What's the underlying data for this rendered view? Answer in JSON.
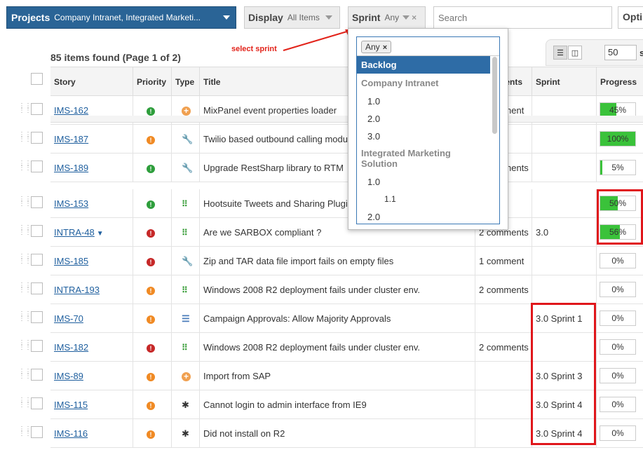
{
  "filters": {
    "projects": {
      "label": "Projects",
      "value": "Company Intranet, Integrated Marketi..."
    },
    "display": {
      "label": "Display",
      "value": "All Items"
    },
    "sprint": {
      "label": "Sprint",
      "value": "Any",
      "clear": "×"
    },
    "search": {
      "placeholder": "Search"
    },
    "options": {
      "label": "Opti"
    }
  },
  "annotation": {
    "text": "select sprint"
  },
  "results": {
    "summary": "85 items found (Page 1 of 2)"
  },
  "view": {
    "page_size": "50",
    "suffix": "s"
  },
  "columns": [
    {
      "label": "Story"
    },
    {
      "label": "Priority"
    },
    {
      "label": "Type"
    },
    {
      "label": "Title"
    },
    {
      "label": "Comments"
    },
    {
      "label": "Sprint"
    },
    {
      "label": "Progress"
    }
  ],
  "rows": [
    {
      "id": "IMS-162",
      "priority": "green",
      "type": "plus",
      "title": "MixPanel event properties loader",
      "comments": "1 comment",
      "sprint": "",
      "progress": 45,
      "progress_label": "45%"
    },
    {
      "id": "IMS-187",
      "priority": "orange",
      "type": "wrench",
      "title": "Twilio based outbound calling module",
      "comments": "",
      "sprint": "",
      "progress": 100,
      "progress_label": "100%"
    },
    {
      "id": "IMS-189",
      "priority": "green",
      "type": "wrench",
      "title": "Upgrade RestSharp library to RTM",
      "comments": "2 comments",
      "sprint": "",
      "progress": 5,
      "progress_label": "5%"
    },
    {
      "id": "IMS-153",
      "priority": "green",
      "type": "dots",
      "title": "Hootsuite Tweets and Sharing Plugin",
      "comments": "",
      "sprint": "",
      "progress": 50,
      "progress_label": "50%"
    },
    {
      "id": "INTRA-48",
      "priority": "red",
      "type": "dots",
      "title": "Are we SARBOX compliant ?",
      "comments": "2 comments",
      "sprint": "3.0",
      "progress": 56,
      "progress_label": "56%",
      "expand": "▼"
    },
    {
      "id": "IMS-185",
      "priority": "red",
      "type": "wrench",
      "title": "Zip and TAR data file import fails on empty files",
      "comments": "1 comment",
      "sprint": "",
      "progress": 0,
      "progress_label": "0%"
    },
    {
      "id": "INTRA-193",
      "priority": "orange",
      "type": "dots",
      "title": "Windows 2008 R2 deployment fails under cluster env.",
      "comments": "2 comments",
      "sprint": "",
      "progress": 0,
      "progress_label": "0%"
    },
    {
      "id": "IMS-70",
      "priority": "orange",
      "type": "list",
      "title": "Campaign Approvals: Allow Majority Approvals",
      "comments": "",
      "sprint": "3.0 Sprint 1",
      "progress": 0,
      "progress_label": "0%"
    },
    {
      "id": "IMS-182",
      "priority": "red",
      "type": "dots",
      "title": "Windows 2008 R2 deployment fails under cluster env.",
      "comments": "2 comments",
      "sprint": "",
      "progress": 0,
      "progress_label": "0%"
    },
    {
      "id": "IMS-89",
      "priority": "orange",
      "type": "plus",
      "title": "Import from SAP",
      "comments": "",
      "sprint": "3.0 Sprint 3",
      "progress": 0,
      "progress_label": "0%"
    },
    {
      "id": "IMS-115",
      "priority": "orange",
      "type": "bug",
      "title": "Cannot login to admin interface from IE9",
      "comments": "",
      "sprint": "3.0 Sprint 4",
      "progress": 0,
      "progress_label": "0%"
    },
    {
      "id": "IMS-116",
      "priority": "orange",
      "type": "bug",
      "title": "Did not install on R2",
      "comments": "",
      "sprint": "3.0 Sprint 4",
      "progress": 0,
      "progress_label": "0%"
    }
  ],
  "sprint_dropdown": {
    "tag": "Any",
    "tag_remove": "×",
    "items": [
      {
        "kind": "sel",
        "label": "Backlog"
      },
      {
        "kind": "group",
        "label": "Company Intranet"
      },
      {
        "kind": "opt",
        "label": "1.0"
      },
      {
        "kind": "opt",
        "label": "2.0"
      },
      {
        "kind": "opt",
        "label": "3.0"
      },
      {
        "kind": "group",
        "label": "Integrated Marketing Solution"
      },
      {
        "kind": "opt",
        "label": "1.0"
      },
      {
        "kind": "sub",
        "label": "1.1"
      },
      {
        "kind": "opt",
        "label": "2.0"
      }
    ]
  },
  "colors": {
    "accent": "#2a6496",
    "highlight": "#e0161b",
    "progress_fill": "#3ac23a"
  }
}
